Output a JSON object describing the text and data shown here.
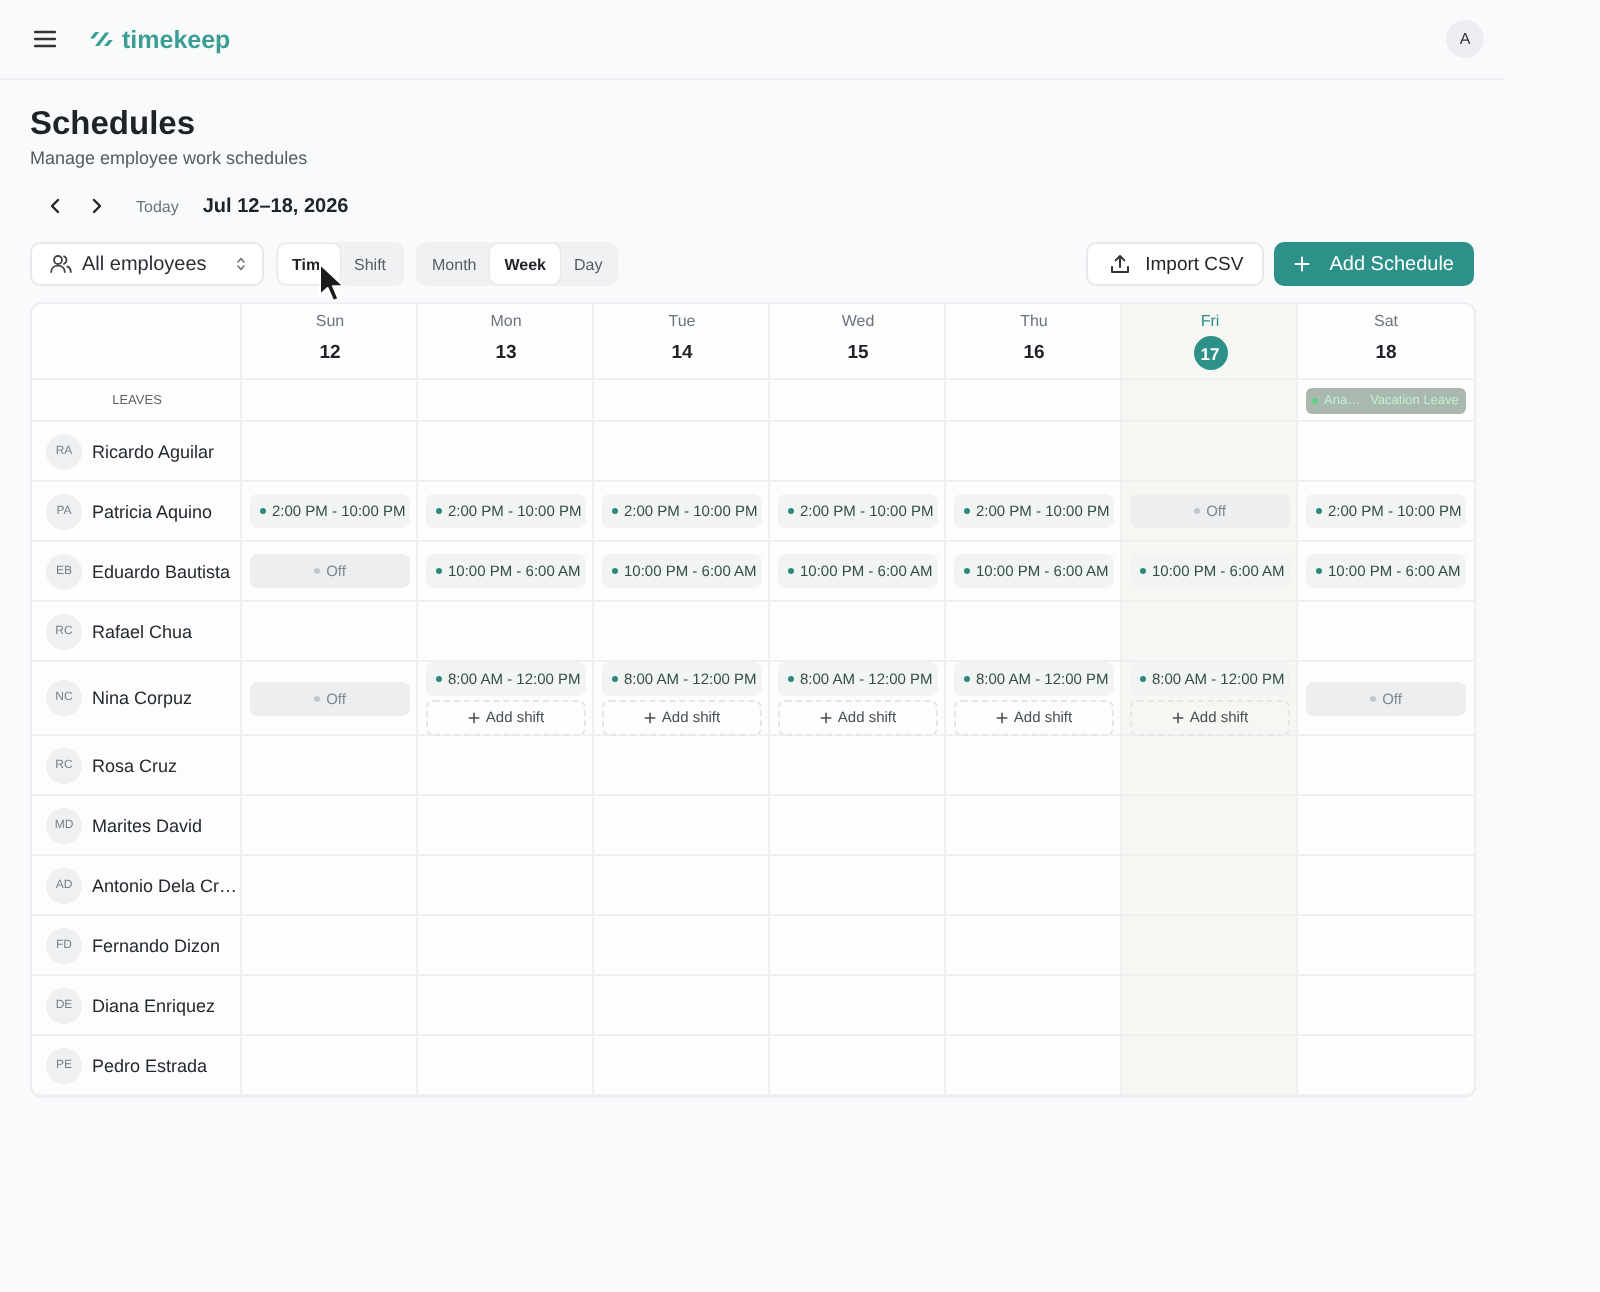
{
  "header": {
    "logo": "timekeep",
    "avatar": "A"
  },
  "page": {
    "title": "Schedules",
    "subtitle": "Manage employee work schedules"
  },
  "date_nav": {
    "today_label": "Today",
    "range": "Jul 12–18, 2026"
  },
  "toolbar": {
    "employee_filter": "All employees",
    "mode_tabs": [
      {
        "label": "Tim",
        "selected": true
      },
      {
        "label": "Shift",
        "selected": false
      }
    ],
    "view_tabs": [
      {
        "label": "Month",
        "selected": false
      },
      {
        "label": "Week",
        "selected": true
      },
      {
        "label": "Day",
        "selected": false
      }
    ],
    "import_button": "Import CSV",
    "add_button": "Add Schedule"
  },
  "calendar": {
    "days": [
      {
        "name": "Sun",
        "date": "12",
        "today": false
      },
      {
        "name": "Mon",
        "date": "13",
        "today": false
      },
      {
        "name": "Tue",
        "date": "14",
        "today": false
      },
      {
        "name": "Wed",
        "date": "15",
        "today": false
      },
      {
        "name": "Thu",
        "date": "16",
        "today": false
      },
      {
        "name": "Fri",
        "date": "17",
        "today": true
      },
      {
        "name": "Sat",
        "date": "18",
        "today": false,
        "leaves": [
          {
            "employee": "Ana…",
            "type": "Vacation Leave"
          }
        ]
      }
    ],
    "leaves_label": "LEAVES",
    "employees": [
      {
        "initials": "RA",
        "name": "Ricardo Aguilar",
        "cells": [
          {
            "kind": "empty"
          },
          {
            "kind": "empty"
          },
          {
            "kind": "empty"
          },
          {
            "kind": "empty"
          },
          {
            "kind": "empty"
          },
          {
            "kind": "empty"
          },
          {
            "kind": "empty"
          }
        ]
      },
      {
        "initials": "PA",
        "name": "Patricia Aquino",
        "cells": [
          {
            "kind": "shift",
            "time": "2:00 PM - 10:00 PM"
          },
          {
            "kind": "shift",
            "time": "2:00 PM - 10:00 PM"
          },
          {
            "kind": "shift",
            "time": "2:00 PM - 10:00 PM"
          },
          {
            "kind": "shift",
            "time": "2:00 PM - 10:00 PM"
          },
          {
            "kind": "shift",
            "time": "2:00 PM - 10:00 PM"
          },
          {
            "kind": "off",
            "label": "Off"
          },
          {
            "kind": "shift",
            "time": "2:00 PM - 10:00 PM"
          }
        ]
      },
      {
        "initials": "EB",
        "name": "Eduardo Bautista",
        "cells": [
          {
            "kind": "off",
            "label": "Off"
          },
          {
            "kind": "shift",
            "time": "10:00 PM - 6:00 AM"
          },
          {
            "kind": "shift",
            "time": "10:00 PM - 6:00 AM"
          },
          {
            "kind": "shift",
            "time": "10:00 PM - 6:00 AM"
          },
          {
            "kind": "shift",
            "time": "10:00 PM - 6:00 AM"
          },
          {
            "kind": "shift",
            "time": "10:00 PM - 6:00 AM"
          },
          {
            "kind": "shift",
            "time": "10:00 PM - 6:00 AM"
          }
        ]
      },
      {
        "initials": "RC",
        "name": "Rafael Chua",
        "cells": [
          {
            "kind": "empty"
          },
          {
            "kind": "empty"
          },
          {
            "kind": "empty"
          },
          {
            "kind": "empty"
          },
          {
            "kind": "empty"
          },
          {
            "kind": "empty"
          },
          {
            "kind": "empty"
          }
        ]
      },
      {
        "initials": "NC",
        "name": "Nina Corpuz",
        "cells": [
          {
            "kind": "off",
            "label": "Off"
          },
          {
            "kind": "shift",
            "time": "8:00 AM - 12:00 PM",
            "add_label": "Add shift"
          },
          {
            "kind": "shift",
            "time": "8:00 AM - 12:00 PM",
            "add_label": "Add shift"
          },
          {
            "kind": "shift",
            "time": "8:00 AM - 12:00 PM",
            "add_label": "Add shift"
          },
          {
            "kind": "shift",
            "time": "8:00 AM - 12:00 PM",
            "add_label": "Add shift"
          },
          {
            "kind": "shift",
            "time": "8:00 AM - 12:00 PM",
            "add_label": "Add shift"
          },
          {
            "kind": "off",
            "label": "Off"
          }
        ]
      },
      {
        "initials": "RC",
        "name": "Rosa Cruz",
        "cells": [
          {
            "kind": "empty"
          },
          {
            "kind": "empty"
          },
          {
            "kind": "empty"
          },
          {
            "kind": "empty"
          },
          {
            "kind": "empty"
          },
          {
            "kind": "empty"
          },
          {
            "kind": "empty"
          }
        ]
      },
      {
        "initials": "MD",
        "name": "Marites David",
        "cells": [
          {
            "kind": "empty"
          },
          {
            "kind": "empty"
          },
          {
            "kind": "empty"
          },
          {
            "kind": "empty"
          },
          {
            "kind": "empty"
          },
          {
            "kind": "empty"
          },
          {
            "kind": "empty"
          }
        ]
      },
      {
        "initials": "AD",
        "name": "Antonio Dela Cr…",
        "cells": [
          {
            "kind": "empty"
          },
          {
            "kind": "empty"
          },
          {
            "kind": "empty"
          },
          {
            "kind": "empty"
          },
          {
            "kind": "empty"
          },
          {
            "kind": "empty"
          },
          {
            "kind": "empty"
          }
        ]
      },
      {
        "initials": "FD",
        "name": "Fernando Dizon",
        "cells": [
          {
            "kind": "empty"
          },
          {
            "kind": "empty"
          },
          {
            "kind": "empty"
          },
          {
            "kind": "empty"
          },
          {
            "kind": "empty"
          },
          {
            "kind": "empty"
          },
          {
            "kind": "empty"
          }
        ]
      },
      {
        "initials": "DE",
        "name": "Diana Enriquez",
        "cells": [
          {
            "kind": "empty"
          },
          {
            "kind": "empty"
          },
          {
            "kind": "empty"
          },
          {
            "kind": "empty"
          },
          {
            "kind": "empty"
          },
          {
            "kind": "empty"
          },
          {
            "kind": "empty"
          }
        ]
      },
      {
        "initials": "PE",
        "name": "Pedro Estrada",
        "cells": [
          {
            "kind": "empty"
          },
          {
            "kind": "empty"
          },
          {
            "kind": "empty"
          },
          {
            "kind": "empty"
          },
          {
            "kind": "empty"
          },
          {
            "kind": "empty"
          },
          {
            "kind": "empty"
          }
        ]
      }
    ]
  }
}
